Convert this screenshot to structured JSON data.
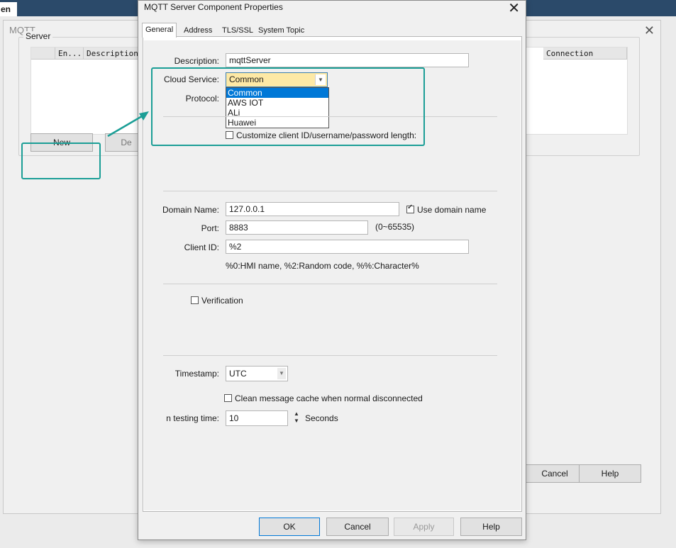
{
  "background_app": {
    "tab_label": "en"
  },
  "background_window": {
    "title": "MQTT",
    "group_label": "Server",
    "columns": [
      "En...",
      "Description",
      "Connection"
    ],
    "new_label": "New",
    "delete_label_partial": "De",
    "cancel_label": "Cancel",
    "help_label": "Help"
  },
  "dialog": {
    "title": "MQTT Server Component Properties",
    "tabs": [
      "General",
      "Address",
      "TLS/SSL",
      "System Topic"
    ],
    "description": {
      "label": "Description:",
      "value": "mqttServer"
    },
    "cloud_service": {
      "label": "Cloud Service:",
      "value": "Common",
      "options": [
        "Common",
        "AWS IOT",
        "ALi",
        "Huawei"
      ]
    },
    "protocol": {
      "label": "Protocol:"
    },
    "customize_length": {
      "label": "Customize client ID/username/password length:",
      "checked": false
    },
    "domain_name": {
      "label": "Domain Name:",
      "value": "127.0.0.1"
    },
    "use_domain_name": {
      "label": "Use domain name",
      "checked": true
    },
    "port": {
      "label": "Port:",
      "value": "8883",
      "range": "(0~65535)"
    },
    "client_id": {
      "label": "Client ID:",
      "value": "%2",
      "hint": "%0:HMI name,  %2:Random code,  %%:Character%"
    },
    "verification": {
      "label": "Verification",
      "checked": false
    },
    "timestamp": {
      "label": "Timestamp:",
      "value": "UTC"
    },
    "clean_cache": {
      "label": "Clean message cache when normal disconnected",
      "checked": false
    },
    "testing_time": {
      "label": "n testing time:",
      "value": "10",
      "unit": "Seconds"
    },
    "buttons": {
      "ok": "OK",
      "cancel": "Cancel",
      "apply": "Apply",
      "help": "Help"
    }
  },
  "colors": {
    "highlight": "#1b9e96",
    "selection": "#0078d7",
    "dropdown_bg": "#fde9a6"
  }
}
